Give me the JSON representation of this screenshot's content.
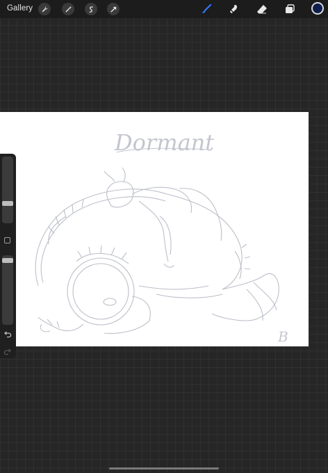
{
  "topbar": {
    "gallery_label": "Gallery",
    "left_tools": [
      "wrench-icon",
      "magic-wand-icon",
      "selection-icon",
      "transform-arrow-icon"
    ],
    "right_tools": [
      "brush-icon",
      "smudge-icon",
      "eraser-icon",
      "layers-icon"
    ],
    "current_color": "#0e1f4d",
    "active_tool_color": "#2f7bff"
  },
  "canvas": {
    "title_text": "Dormant",
    "signature_text": "B",
    "sketch_color": "#b9bcc7"
  },
  "sidebar": {
    "brush_size_level": 0.7,
    "opacity_level": 0.05
  }
}
